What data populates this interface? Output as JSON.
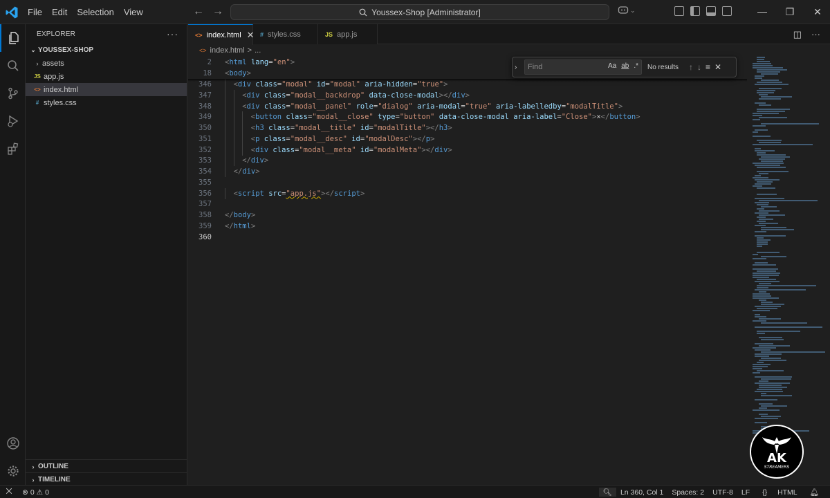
{
  "menu": [
    "File",
    "Edit",
    "Selection",
    "View"
  ],
  "command_center": {
    "text": "Youssex-Shop [Administrator]"
  },
  "sidebar": {
    "title": "EXPLORER",
    "more": "···",
    "root_folder": "YOUSSEX-SHOP",
    "items": [
      {
        "label": "assets",
        "kind": "folder"
      },
      {
        "label": "app.js",
        "kind": "js",
        "icon_text": "JS"
      },
      {
        "label": "index.html",
        "kind": "html",
        "icon_text": "<>"
      },
      {
        "label": "styles.css",
        "kind": "css",
        "icon_text": "#"
      }
    ],
    "outline": "OUTLINE",
    "timeline": "TIMELINE"
  },
  "tabs": [
    {
      "label": "index.html",
      "icon_text": "<>",
      "active": true
    },
    {
      "label": "styles.css",
      "icon_text": "#",
      "active": false
    },
    {
      "label": "app.js",
      "icon_text": "JS",
      "active": false
    }
  ],
  "breadcrumb": {
    "file": "index.html",
    "sep": ">",
    "rest": "..."
  },
  "find": {
    "placeholder": "Find",
    "status": "No results",
    "case_label": "Aa",
    "word_label": "ab",
    "regex_label": ".*"
  },
  "code": {
    "sticky": [
      {
        "ln": "2",
        "tokens": [
          [
            "p",
            "<"
          ],
          [
            "t",
            "html"
          ],
          [
            "x",
            " "
          ],
          [
            "a",
            "lang"
          ],
          [
            "x",
            "="
          ],
          [
            "s",
            "\"en\""
          ],
          [
            "p",
            ">"
          ]
        ]
      },
      {
        "ln": "18",
        "tokens": [
          [
            "p",
            "<"
          ],
          [
            "t",
            "body"
          ],
          [
            "p",
            ">"
          ]
        ]
      }
    ],
    "lines": [
      {
        "ln": "346",
        "indent": 1,
        "tokens": [
          [
            "p",
            "<"
          ],
          [
            "t",
            "div"
          ],
          [
            "x",
            " "
          ],
          [
            "a",
            "class"
          ],
          [
            "x",
            "="
          ],
          [
            "s",
            "\"modal\""
          ],
          [
            "x",
            " "
          ],
          [
            "a",
            "id"
          ],
          [
            "x",
            "="
          ],
          [
            "s",
            "\"modal\""
          ],
          [
            "x",
            " "
          ],
          [
            "a",
            "aria-hidden"
          ],
          [
            "x",
            "="
          ],
          [
            "s",
            "\"true\""
          ],
          [
            "p",
            ">"
          ]
        ]
      },
      {
        "ln": "347",
        "indent": 2,
        "tokens": [
          [
            "p",
            "<"
          ],
          [
            "t",
            "div"
          ],
          [
            "x",
            " "
          ],
          [
            "a",
            "class"
          ],
          [
            "x",
            "="
          ],
          [
            "s",
            "\"modal__backdrop\""
          ],
          [
            "x",
            " "
          ],
          [
            "a",
            "data-close-modal"
          ],
          [
            "p",
            "></"
          ],
          [
            "t",
            "div"
          ],
          [
            "p",
            ">"
          ]
        ]
      },
      {
        "ln": "348",
        "indent": 2,
        "tokens": [
          [
            "p",
            "<"
          ],
          [
            "t",
            "div"
          ],
          [
            "x",
            " "
          ],
          [
            "a",
            "class"
          ],
          [
            "x",
            "="
          ],
          [
            "s",
            "\"modal__panel\""
          ],
          [
            "x",
            " "
          ],
          [
            "a",
            "role"
          ],
          [
            "x",
            "="
          ],
          [
            "s",
            "\"dialog\""
          ],
          [
            "x",
            " "
          ],
          [
            "a",
            "aria-modal"
          ],
          [
            "x",
            "="
          ],
          [
            "s",
            "\"true\""
          ],
          [
            "x",
            " "
          ],
          [
            "a",
            "aria-labelledby"
          ],
          [
            "x",
            "="
          ],
          [
            "s",
            "\"modalTitle\""
          ],
          [
            "p",
            ">"
          ]
        ]
      },
      {
        "ln": "349",
        "indent": 3,
        "tokens": [
          [
            "p",
            "<"
          ],
          [
            "t",
            "button"
          ],
          [
            "x",
            " "
          ],
          [
            "a",
            "class"
          ],
          [
            "x",
            "="
          ],
          [
            "s",
            "\"modal__close\""
          ],
          [
            "x",
            " "
          ],
          [
            "a",
            "type"
          ],
          [
            "x",
            "="
          ],
          [
            "s",
            "\"button\""
          ],
          [
            "x",
            " "
          ],
          [
            "a",
            "data-close-modal"
          ],
          [
            "x",
            " "
          ],
          [
            "a",
            "aria-label"
          ],
          [
            "x",
            "="
          ],
          [
            "s",
            "\"Close\""
          ],
          [
            "p",
            ">"
          ],
          [
            "x",
            "×"
          ],
          [
            "p",
            "</"
          ],
          [
            "t",
            "button"
          ],
          [
            "p",
            ">"
          ]
        ]
      },
      {
        "ln": "350",
        "indent": 3,
        "tokens": [
          [
            "p",
            "<"
          ],
          [
            "t",
            "h3"
          ],
          [
            "x",
            " "
          ],
          [
            "a",
            "class"
          ],
          [
            "x",
            "="
          ],
          [
            "s",
            "\"modal__title\""
          ],
          [
            "x",
            " "
          ],
          [
            "a",
            "id"
          ],
          [
            "x",
            "="
          ],
          [
            "s",
            "\"modalTitle\""
          ],
          [
            "p",
            "></"
          ],
          [
            "t",
            "h3"
          ],
          [
            "p",
            ">"
          ]
        ]
      },
      {
        "ln": "351",
        "indent": 3,
        "tokens": [
          [
            "p",
            "<"
          ],
          [
            "t",
            "p"
          ],
          [
            "x",
            " "
          ],
          [
            "a",
            "class"
          ],
          [
            "x",
            "="
          ],
          [
            "s",
            "\"modal__desc\""
          ],
          [
            "x",
            " "
          ],
          [
            "a",
            "id"
          ],
          [
            "x",
            "="
          ],
          [
            "s",
            "\"modalDesc\""
          ],
          [
            "p",
            "></"
          ],
          [
            "t",
            "p"
          ],
          [
            "p",
            ">"
          ]
        ]
      },
      {
        "ln": "352",
        "indent": 3,
        "tokens": [
          [
            "p",
            "<"
          ],
          [
            "t",
            "div"
          ],
          [
            "x",
            " "
          ],
          [
            "a",
            "class"
          ],
          [
            "x",
            "="
          ],
          [
            "s",
            "\"modal__meta\""
          ],
          [
            "x",
            " "
          ],
          [
            "a",
            "id"
          ],
          [
            "x",
            "="
          ],
          [
            "s",
            "\"modalMeta\""
          ],
          [
            "p",
            "></"
          ],
          [
            "t",
            "div"
          ],
          [
            "p",
            ">"
          ]
        ]
      },
      {
        "ln": "353",
        "indent": 2,
        "tokens": [
          [
            "p",
            "</"
          ],
          [
            "t",
            "div"
          ],
          [
            "p",
            ">"
          ]
        ]
      },
      {
        "ln": "354",
        "indent": 1,
        "tokens": [
          [
            "p",
            "</"
          ],
          [
            "t",
            "div"
          ],
          [
            "p",
            ">"
          ]
        ]
      },
      {
        "ln": "355",
        "indent": 0,
        "tokens": []
      },
      {
        "ln": "356",
        "indent": 1,
        "tokens": [
          [
            "p",
            "<"
          ],
          [
            "t",
            "script"
          ],
          [
            "x",
            " "
          ],
          [
            "a",
            "src"
          ],
          [
            "x",
            "="
          ],
          [
            "sq",
            "\"app.js\""
          ],
          [
            "p",
            "></"
          ],
          [
            "t",
            "script"
          ],
          [
            "p",
            ">"
          ]
        ]
      },
      {
        "ln": "357",
        "indent": 0,
        "tokens": []
      },
      {
        "ln": "358",
        "indent": 0,
        "tokens": [
          [
            "p",
            "</"
          ],
          [
            "t",
            "body"
          ],
          [
            "p",
            ">"
          ]
        ]
      },
      {
        "ln": "359",
        "indent": 0,
        "tokens": [
          [
            "p",
            "</"
          ],
          [
            "t",
            "html"
          ],
          [
            "p",
            ">"
          ]
        ]
      },
      {
        "ln": "360",
        "indent": 0,
        "tokens": [],
        "current": true
      }
    ]
  },
  "statusbar": {
    "errors": "0",
    "warnings": "0",
    "position": "Ln 360, Col 1",
    "spaces": "Spaces: 2",
    "encoding": "UTF-8",
    "eol": "LF",
    "language": "HTML"
  },
  "watermark": {
    "text": "AK",
    "sub": "STREAMERS"
  },
  "colors": {
    "accent": "#0078d4",
    "tag": "#569cd6",
    "attr": "#9cdcfe",
    "string": "#ce9178",
    "punct": "#808080"
  }
}
